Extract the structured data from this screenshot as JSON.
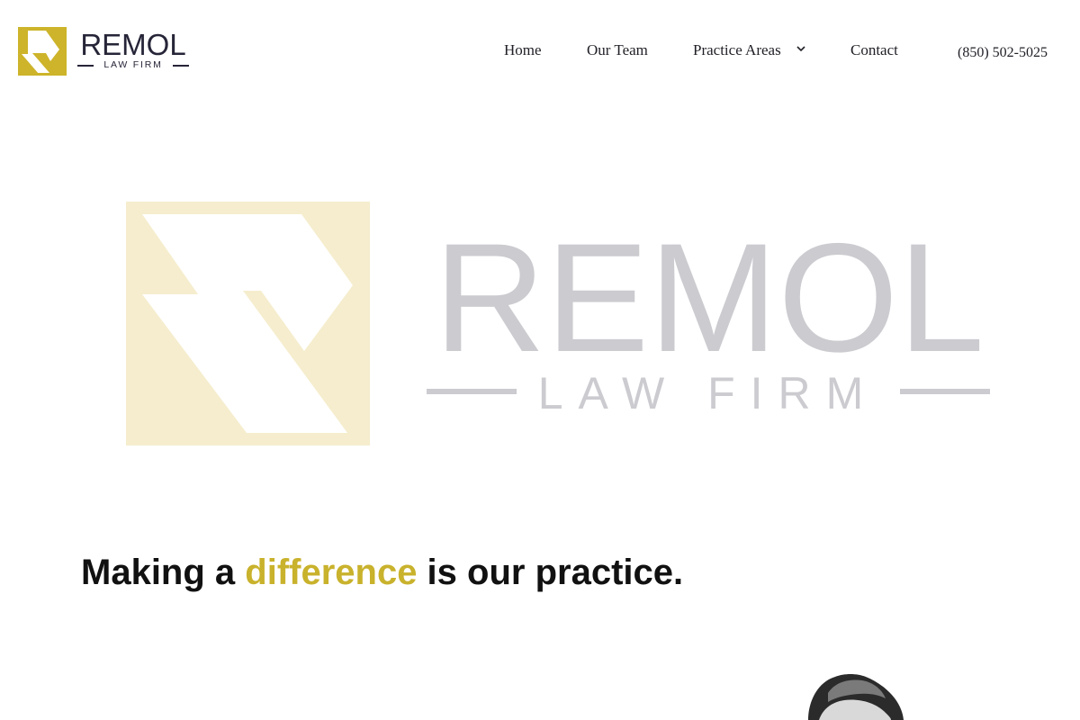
{
  "brand": {
    "name": "REMOL",
    "subtitle": "LAW FIRM",
    "accent_color": "#cdb42a",
    "text_color": "#262538"
  },
  "nav": {
    "items": [
      {
        "label": "Home"
      },
      {
        "label": "Our Team"
      },
      {
        "label": "Practice Areas",
        "icon": "chevron-down-icon"
      },
      {
        "label": "Contact"
      }
    ],
    "phone": "(850) 502-5025"
  },
  "hero": {
    "wordmark": "REMOL",
    "subtitle": "LAW FIRM",
    "mark_color": "#f5edcd",
    "word_color": "#cbcbd0"
  },
  "tagline": {
    "before": "Making a ",
    "accent": "difference",
    "after": " is our practice."
  }
}
